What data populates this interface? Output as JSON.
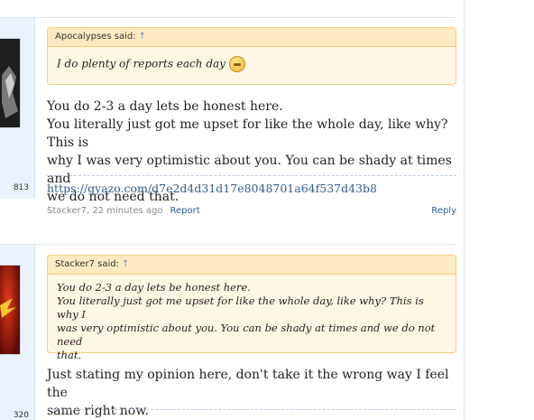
{
  "posts": [
    {
      "post_count": "813",
      "quote": {
        "author_said": "Apocalypses said:",
        "arrow": "↑",
        "text": "I do plenty of reports each day",
        "emoji": "smiley-icon"
      },
      "message_lines": [
        "You do 2-3 a day lets be honest here.",
        "You literally just got me upset for like the whole day, like why? This is",
        "why I was very optimistic about you. You can be shady at times and",
        "we do not need that."
      ],
      "link": "https://gyazo.com/d7e2d4d31d17e8048701a64f537d43b8",
      "author_meta": "Stacker7, 22 minutes ago",
      "report_label": "Report",
      "reply_label": "Reply"
    },
    {
      "post_count": "320",
      "quote": {
        "author_said": "Stacker7 said:",
        "arrow": "↑",
        "lines": [
          "You do 2-3 a day lets be honest here.",
          "You literally just got me upset for like the whole day, like why? This is why I",
          "was very optimistic about you. You can be shady at times and we do not need",
          "that."
        ]
      },
      "message_lines": [
        "Just stating my opinion here, don't take it the wrong way I feel the",
        "same right now."
      ]
    }
  ],
  "colors": {
    "quote_border": "#f5cf7a",
    "quote_bg": "#fff7e6",
    "link": "#2f5e8e",
    "userbox_bg": "#eaf3fb"
  }
}
